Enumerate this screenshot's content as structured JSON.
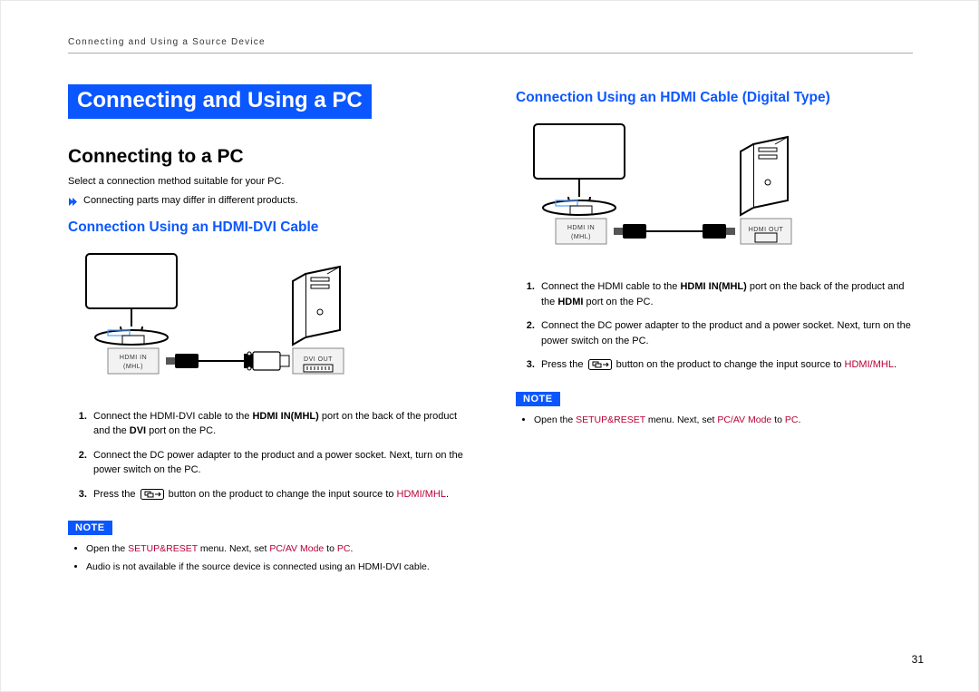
{
  "running_head": "Connecting and Using a Source Device",
  "page_number": "31",
  "left": {
    "chapter_title": "Connecting and Using a PC",
    "section_title": "Connecting to a PC",
    "intro": "Select a connection method suitable for your PC.",
    "intro_bullet": "Connecting parts may differ in different products.",
    "subsection_title": "Connection Using an HDMI-DVI Cable",
    "figure": {
      "port_in": "HDMI IN",
      "port_in_sub": "(MHL)",
      "port_out": "DVI OUT"
    },
    "steps": {
      "s1_a": "Connect the HDMI-DVI cable to the ",
      "s1_b": "HDMI IN(MHL)",
      "s1_c": " port on the back of the product and the ",
      "s1_d": "DVI",
      "s1_e": " port on the PC.",
      "s2": "Connect the DC power adapter to the product and a power socket. Next, turn on the power switch on the PC.",
      "s3_a": "Press the ",
      "s3_b": " button on the product to change the input source to ",
      "s3_c": "HDMI/MHL",
      "s3_d": "."
    },
    "note_label": "NOTE",
    "notes": {
      "n1_a": "Open the ",
      "n1_b": "SETUP&RESET",
      "n1_c": " menu. Next, set ",
      "n1_d": "PC/AV Mode",
      "n1_e": " to ",
      "n1_f": "PC",
      "n1_g": ".",
      "n2": "Audio is not available if the source device is connected using an HDMI-DVI cable."
    }
  },
  "right": {
    "subsection_title": "Connection Using an HDMI Cable (Digital Type)",
    "figure": {
      "port_in": "HDMI IN",
      "port_in_sub": "(MHL)",
      "port_out": "HDMI OUT"
    },
    "steps": {
      "s1_a": "Connect the HDMI cable to the ",
      "s1_b": "HDMI IN(MHL)",
      "s1_c": " port on the back of the product and the ",
      "s1_d": "HDMI",
      "s1_e": " port on the PC.",
      "s2": "Connect the DC power adapter to the product and a power socket. Next, turn on the power switch on the PC.",
      "s3_a": "Press the ",
      "s3_b": " button on the product to change the input source to ",
      "s3_c": "HDMI/MHL",
      "s3_d": "."
    },
    "note_label": "NOTE",
    "notes": {
      "n1_a": "Open the ",
      "n1_b": "SETUP&RESET",
      "n1_c": " menu. Next, set ",
      "n1_d": "PC/AV Mode",
      "n1_e": " to ",
      "n1_f": "PC",
      "n1_g": "."
    }
  }
}
